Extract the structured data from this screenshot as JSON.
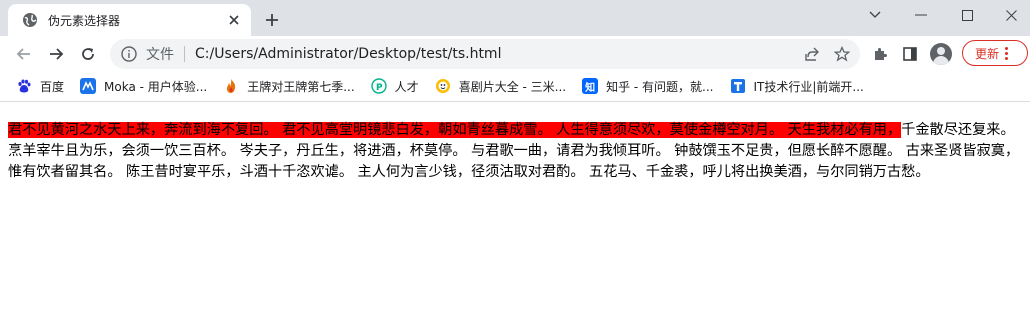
{
  "browser": {
    "tab_title": "伪元素选择器",
    "url_label": "文件",
    "url": "C:/Users/Administrator/Desktop/test/ts.html",
    "update_label": "更新"
  },
  "bookmarks": [
    {
      "label": "百度",
      "icon": "baidu-paw-icon",
      "color": "#2932e1"
    },
    {
      "label": "Moka - 用户体验...",
      "icon": "moka-icon",
      "color": "#1a73e8"
    },
    {
      "label": "王牌对王牌第七季...",
      "icon": "flame-icon",
      "color": "#e8710a"
    },
    {
      "label": "人才",
      "icon": "lagou-icon",
      "color": "#00b38a"
    },
    {
      "label": "喜剧片大全 - 三米...",
      "icon": "smiley-icon",
      "color": "#f9ab00"
    },
    {
      "label": "知乎 - 有问题，就...",
      "icon": "zhihu-icon",
      "color": "#0066ff"
    },
    {
      "label": "IT技术行业|前端开...",
      "icon": "it-icon",
      "color": "#1a73e8"
    }
  ],
  "content": {
    "first_line": "君不见黄河之水天上来，奔流到海不复回。 君不见高堂明镜悲白发，朝如青丝暮成雪。 人生得意须尽欢，莫使金樽空对月。 天生我材必有用，",
    "rest": "千金散尽还复来。 烹羊宰牛且为乐，会须一饮三百杯。 岑夫子，丹丘生，将进酒，杯莫停。 与君歌一曲，请君为我倾耳听。 钟鼓馔玉不足贵，但愿长醉不愿醒。 古来圣贤皆寂寞，惟有饮者留其名。 陈王昔时宴平乐，斗酒十千恣欢谑。 主人何为言少钱，径须沽取对君酌。 五花马、千金裘，呼儿将出换美酒，与尔同销万古愁。",
    "highlight_color": "#ff0000"
  }
}
